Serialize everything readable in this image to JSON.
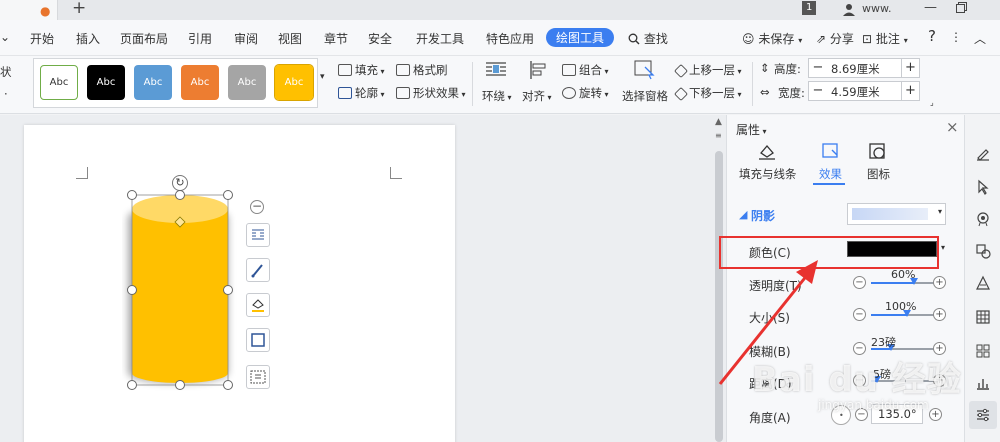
{
  "titlebar": {
    "page_num": "1",
    "user": "www."
  },
  "menu": {
    "items": [
      "开始",
      "插入",
      "页面布局",
      "引用",
      "审阅",
      "视图",
      "章节",
      "安全",
      "开发工具",
      "特色应用",
      "绘图工具"
    ],
    "search": "查找",
    "unsaved": "未保存",
    "share": "分享",
    "comment": "批注",
    "help": "?"
  },
  "ribbon": {
    "left_cut_1": "状",
    "left_cut_2": "·",
    "style_label": "Abc",
    "fill": "填充",
    "format_painter": "格式刷",
    "outline": "轮廓",
    "shape_effect": "形状效果",
    "wrap": "环绕",
    "align": "对齐",
    "group": "组合",
    "rotate": "旋转",
    "select_pane": "选择窗格",
    "bring_forward": "上移一层",
    "send_backward": "下移一层",
    "height_label": "高度:",
    "height_value": "8.69厘米",
    "width_label": "宽度:",
    "width_value": "4.59厘米"
  },
  "panel": {
    "title": "属性",
    "tabs": [
      "填充与线条",
      "效果",
      "图标"
    ],
    "section": "阴影",
    "color_label": "颜色(C)",
    "transparency_label": "透明度(T)",
    "transparency_value": "60%",
    "transparency_pct": 0.6,
    "size_label": "大小(S)",
    "size_value": "100%",
    "size_pct": 0.5,
    "blur_label": "模糊(B)",
    "blur_value": "23磅",
    "blur_pct": 0.28,
    "distance_label": "距离(D)",
    "distance_value": "5磅",
    "distance_pct": 0.08,
    "angle_label": "角度(A)",
    "angle_value": "135.0°"
  },
  "watermark": {
    "text": "Bai du 经验",
    "sub": "jingyan.baidu.com"
  },
  "colors": {
    "accent": "#3b7ef0",
    "cylinder": "#ffc000",
    "cylinder_top": "#ffd966",
    "highlight_box": "#e8322f",
    "arrow": "#e8322f"
  }
}
